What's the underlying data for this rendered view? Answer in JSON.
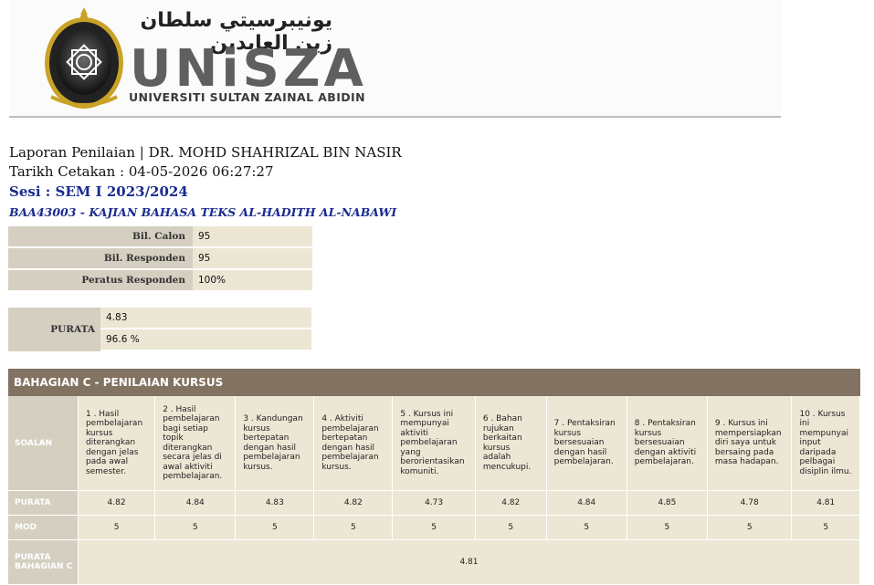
{
  "header": {
    "jawi": "يونيبرسيتي سلطان زين العابدين",
    "brand": "UNiSZA",
    "subtitle": "UNIVERSITI SULTAN ZAINAL ABIDIN"
  },
  "report": {
    "title_line": "Laporan Penilaian | DR. MOHD SHAHRIZAL BIN NASIR",
    "print_date": "Tarikh Cetakan : 04-05-2026 06:27:27",
    "session": "Sesi : SEM I 2023/2024",
    "course": "BAA43003 - KAJIAN BAHASA TEKS AL-HADITH AL-NABAWI"
  },
  "stats": [
    {
      "label": "Bil. Calon",
      "value": "95"
    },
    {
      "label": "Bil. Responden",
      "value": "95"
    },
    {
      "label": "Peratus Responden",
      "value": "100%"
    }
  ],
  "purata": {
    "label": "PURATA",
    "score": "4.83",
    "percent": "96.6 %"
  },
  "section_c": {
    "title": "BAHAGIAN C - PENILAIAN KURSUS",
    "row_labels": {
      "soalan": "SOALAN",
      "purata": "PURATA",
      "mod": "MOD",
      "overall": "PURATA BAHAGIAN C"
    },
    "questions": [
      "1 . Hasil pembelajaran kursus diterangkan dengan jelas pada awal semester.",
      "2 . Hasil pembelajaran bagi setiap topik diterangkan secara jelas di awal aktiviti pembelajaran.",
      "3 . Kandungan kursus bertepatan dengan hasil pembelajaran kursus.",
      "4 . Aktiviti pembelajaran bertepatan dengan hasil pembelajaran kursus.",
      "5 . Kursus ini mempunyai aktiviti pembelajaran yang berorientasikan komuniti.",
      "6 . Bahan rujukan berkaitan kursus adalah mencukupi.",
      "7 . Pentaksiran kursus bersesuaian dengan hasil pembelajaran.",
      "8 . Pentaksiran kursus bersesuaian dengan aktiviti pembelajaran.",
      "9 . Kursus ini mempersiapkan diri saya untuk bersaing pada masa hadapan.",
      "10 . Kursus ini mempunyai input daripada pelbagai disiplin ilmu."
    ],
    "purata": [
      "4.82",
      "4.84",
      "4.83",
      "4.82",
      "4.73",
      "4.82",
      "4.84",
      "4.85",
      "4.78",
      "4.81"
    ],
    "mod": [
      "5",
      "5",
      "5",
      "5",
      "5",
      "5",
      "5",
      "5",
      "5",
      "5"
    ],
    "overall": "4.81"
  }
}
